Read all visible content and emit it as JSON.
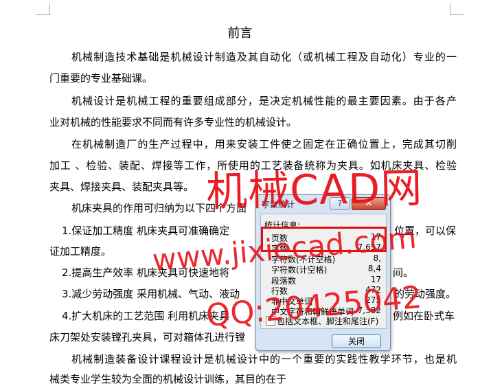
{
  "document": {
    "title": "前言",
    "lines": [
      {
        "text": "机械制造技术基础是机械设计制造及其自动化（或机械工程及自动化）专业的一",
        "indent": true,
        "justify": true
      },
      {
        "text": "门重要的专业基础课。",
        "indent": false,
        "justify": false
      },
      {
        "text": "机械设计是机械工程的重要组成部分，是决定机械性能的最主要因素。由于各产",
        "indent": true,
        "justify": true
      },
      {
        "text": "业对机械的性能要求不同而有许多专业性的机械设计。",
        "indent": false,
        "justify": false
      },
      {
        "text": "在机械制造厂的生产过程中，用来安装工件使之固定在正确位置上，完成其切削",
        "indent": true,
        "justify": true
      },
      {
        "text": "加工 、检验、装配、焊接等工作，所使用的工艺装备统称为夹具。如机床夹具、检验",
        "indent": false,
        "justify": true
      },
      {
        "text": "夹具、焊接夹具、装配夹具等。",
        "indent": false,
        "justify": false
      },
      {
        "text": "机床夹具的作用可归纳为以下四个方面",
        "indent": true,
        "justify": false
      },
      {
        "text": "1.保证加工精度    机床夹具可准确确定",
        "indent": "small",
        "justify": false
      },
      {
        "text": "证加工精度。",
        "indent": false,
        "justify": false
      },
      {
        "text": "2.提高生产效率    机床夹具可快速地将",
        "indent": "small",
        "justify": false
      },
      {
        "text": "3.减少劳动强度    采用机械、气动、液动",
        "indent": "small",
        "justify": false
      },
      {
        "text": "4.扩大机床的工艺范围    利用机床夹具",
        "indent": "small",
        "justify": false
      },
      {
        "text": "床刀架处安装镗孔夹具，可对箱体孔进行镗",
        "indent": false,
        "justify": false
      },
      {
        "text": "机械制造装备设计课程设计是机械设计中的一个重要的实践性教学环节，也是机",
        "indent": true,
        "justify": true
      },
      {
        "text": "械类专业学生较为全面的机械设计训练，其目的在于",
        "indent": false,
        "justify": false
      }
    ],
    "right_fragments": [
      {
        "text": "位置，可以保"
      },
      {
        "text": "间。"
      },
      {
        "text": "的劳动强度。"
      },
      {
        "text": "例如在卧式车"
      }
    ]
  },
  "dialog": {
    "title": "字数统计",
    "help_label": "?",
    "close_x": "✕",
    "section_label": "统计信息:",
    "stats": [
      {
        "label": "页数",
        "value": "17"
      },
      {
        "label": "字数",
        "value": "7,657"
      },
      {
        "label": "字符数(不计空格)",
        "value": "8,"
      },
      {
        "label": "字符数(计空格)",
        "value": "8,4"
      },
      {
        "label": "段落数",
        "value": "17"
      },
      {
        "label": "行数",
        "value": "472"
      },
      {
        "label": "非中文单词",
        "value": "275"
      },
      {
        "label": "中文字符和朝鲜语单词",
        "value": "7,382"
      }
    ],
    "checkbox_label": "包括文本框、脚注和尾注(F)",
    "close_button": "关闭"
  },
  "watermark": {
    "line1": "机械CAD网",
    "line2": "www.jixiecad.com",
    "line3": "QQ:20425042",
    "color": "#e8131a"
  }
}
